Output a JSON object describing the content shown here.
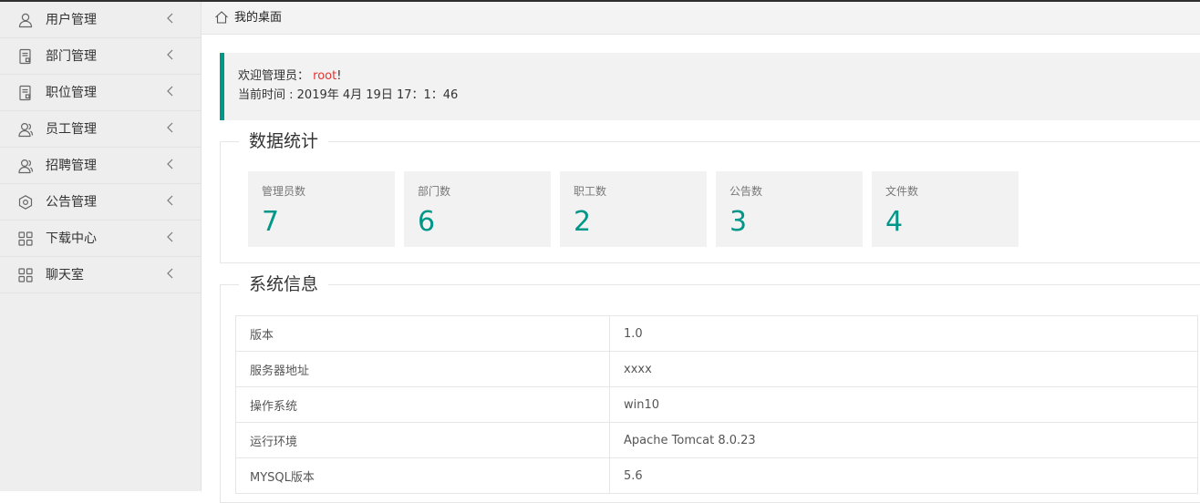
{
  "sidebar": {
    "items": [
      {
        "label": "用户管理",
        "icon": "user-icon"
      },
      {
        "label": "部门管理",
        "icon": "document-icon"
      },
      {
        "label": "职位管理",
        "icon": "document-icon"
      },
      {
        "label": "员工管理",
        "icon": "users-icon"
      },
      {
        "label": "招聘管理",
        "icon": "users-icon"
      },
      {
        "label": "公告管理",
        "icon": "notice-icon"
      },
      {
        "label": "下载中心",
        "icon": "grid-icon"
      },
      {
        "label": "聊天室",
        "icon": "grid-icon"
      }
    ]
  },
  "breadcrumb": {
    "label": "我的桌面"
  },
  "welcome": {
    "greeting": "欢迎管理员：",
    "username": "root",
    "exclaim": "!",
    "time_label": "当前时间 : ",
    "time_value": "2019年 4月 19日 17：1：46"
  },
  "stats": {
    "legend": "数据统计",
    "cards": [
      {
        "label": "管理员数",
        "value": "7"
      },
      {
        "label": "部门数",
        "value": "6"
      },
      {
        "label": "职工数",
        "value": "2"
      },
      {
        "label": "公告数",
        "value": "3"
      },
      {
        "label": "文件数",
        "value": "4"
      }
    ]
  },
  "system": {
    "legend": "系统信息",
    "rows": [
      {
        "key": "版本",
        "value": "1.0"
      },
      {
        "key": "服务器地址",
        "value": "xxxx"
      },
      {
        "key": "操作系统",
        "value": "win10"
      },
      {
        "key": "运行环境",
        "value": "Apache Tomcat 8.0.23"
      },
      {
        "key": "MYSQL版本",
        "value": "5.6"
      }
    ]
  },
  "colors": {
    "accent": "#009688",
    "username": "#e5332e"
  }
}
